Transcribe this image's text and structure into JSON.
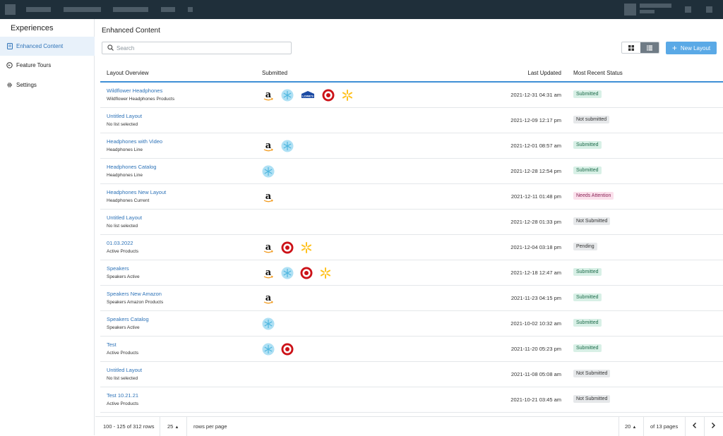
{
  "sidebar": {
    "title": "Experiences",
    "items": [
      {
        "label": "Enhanced Content",
        "icon": "document-icon"
      },
      {
        "label": "Feature Tours",
        "icon": "tour-icon"
      },
      {
        "label": "Settings",
        "icon": "gear-icon"
      }
    ]
  },
  "page": {
    "title": "Enhanced Content",
    "search_placeholder": "Search",
    "new_layout_label": "New Layout"
  },
  "colors": {
    "topbar": "#1f2f3a",
    "accent": "#3f8fd6",
    "link": "#2e73b8",
    "primary_button": "#5aa9e6",
    "submitted_bg": "#d8f0e6",
    "attention_bg": "#fbe0ec",
    "neutral_bg": "#e6e8ea"
  },
  "table": {
    "headers": {
      "overview": "Layout Overview",
      "submitted": "Submitted",
      "updated": "Last Updated",
      "status": "Most Recent Status"
    },
    "rows": [
      {
        "title": "Wildflower Headphones",
        "sub": "Wildflower Headphones Products",
        "logos": [
          "amazon",
          "walmart-spark",
          "lowes",
          "target",
          "walmart"
        ],
        "updated": "2021-12-31 04:31 am",
        "status": "Submitted",
        "kind": "ok"
      },
      {
        "title": "Untitled Layout",
        "sub": "No list selected",
        "logos": [],
        "updated": "2021-12-09 12:17 pm",
        "status": "Not submitted",
        "kind": "neutral"
      },
      {
        "title": "Headphones with Video",
        "sub": "Headphones Line",
        "logos": [
          "amazon",
          "walmart-spark"
        ],
        "updated": "2021-12-01 08:57 am",
        "status": "Submitted",
        "kind": "ok"
      },
      {
        "title": "Headphones Catalog",
        "sub": "Headphones Line",
        "logos": [
          "walmart-spark"
        ],
        "updated": "2021-12-28 12:54 pm",
        "status": "Submitted",
        "kind": "ok"
      },
      {
        "title": "Headphones New Layout",
        "sub": "Headphones Current",
        "logos": [
          "amazon"
        ],
        "updated": "2021-12-11 01:48 pm",
        "status": "Needs Attention",
        "kind": "attn"
      },
      {
        "title": "Untitled Layout",
        "sub": "No list selected",
        "logos": [],
        "updated": "2021-12-28 01:33 pm",
        "status": "Not Submitted",
        "kind": "neutral"
      },
      {
        "title": "01.03.2022",
        "sub": "Active Products",
        "logos": [
          "amazon",
          "target",
          "walmart"
        ],
        "updated": "2021-12-04 03:18 pm",
        "status": "Pending",
        "kind": "neutral"
      },
      {
        "title": "Speakers",
        "sub": "Speakers Active",
        "logos": [
          "amazon",
          "walmart-spark",
          "target",
          "walmart"
        ],
        "updated": "2021-12-18 12:47 am",
        "status": "Submitted",
        "kind": "ok"
      },
      {
        "title": "Speakers New Amazon",
        "sub": "Speakers Amazon Products",
        "logos": [
          "amazon"
        ],
        "updated": "2021-11-23 04:15 pm",
        "status": "Submitted",
        "kind": "ok"
      },
      {
        "title": "Speakers Catalog",
        "sub": "Speakers Active",
        "logos": [
          "walmart-spark"
        ],
        "updated": "2021-10-02 10:32 am",
        "status": "Submitted",
        "kind": "ok"
      },
      {
        "title": "Test",
        "sub": "Active Products",
        "logos": [
          "walmart-spark",
          "target"
        ],
        "updated": "2021-11-20 05:23 pm",
        "status": "Submitted",
        "kind": "ok"
      },
      {
        "title": "Untitled Layout",
        "sub": "No list selected",
        "logos": [],
        "updated": "2021-11-08 05:08 am",
        "status": "Not Submitted",
        "kind": "neutral"
      },
      {
        "title": "Test 10.21.21",
        "sub": "Active Products",
        "logos": [],
        "updated": "2021-10-21 03:45 am",
        "status": "Not Submitted",
        "kind": "neutral"
      }
    ]
  },
  "footer": {
    "range": "100 - 125 of 312 rows",
    "per_page_value": "25",
    "per_page_label": "rows per page",
    "page_value": "20",
    "pages_label": "of 13 pages"
  }
}
